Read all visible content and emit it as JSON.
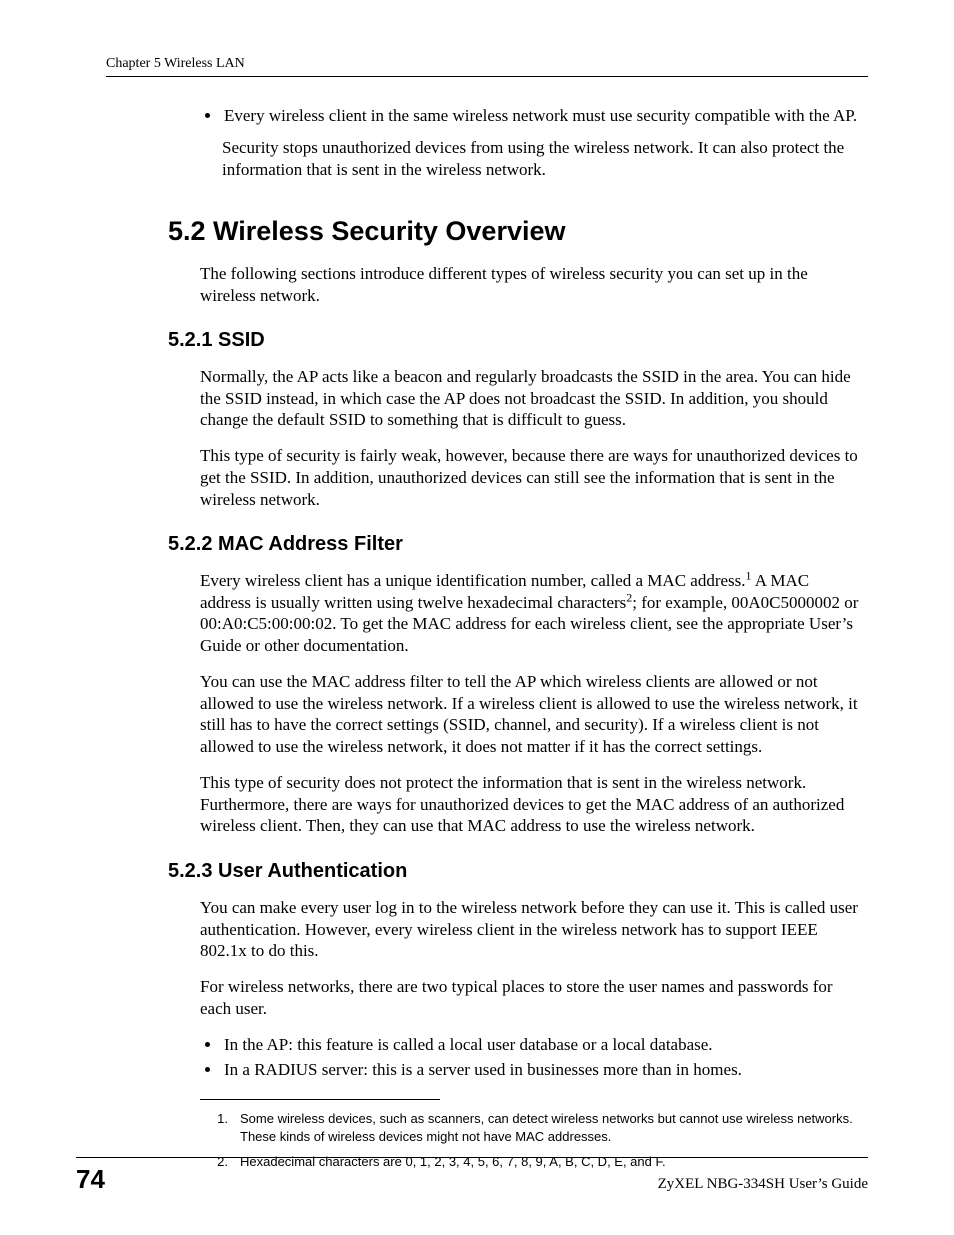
{
  "header": {
    "chapter": "Chapter 5 Wireless LAN"
  },
  "intro": {
    "bullet": "Every wireless client in the same wireless network must use security compatible with the AP.",
    "after": "Security stops unauthorized devices from using the wireless network. It can also protect the information that is sent in the wireless network."
  },
  "section": {
    "num_title": "5.2  Wireless Security Overview",
    "intro": "The following sections introduce different types of wireless security you can set up in the wireless network."
  },
  "ssid": {
    "heading": "5.2.1  SSID",
    "p1": "Normally, the AP acts like a beacon and regularly broadcasts the SSID in the area. You can hide the SSID instead, in which case the AP does not broadcast the SSID. In addition, you should change the default SSID to something that is difficult to guess.",
    "p2": "This type of security is fairly weak, however, because there are ways for unauthorized devices to get the SSID. In addition, unauthorized devices can still see the information that is sent in the wireless network."
  },
  "mac": {
    "heading": "5.2.2  MAC Address Filter",
    "p1a": "Every wireless client has a unique identification number, called a MAC address.",
    "p1b": " A MAC address is usually written using twelve hexadecimal characters",
    "p1c": "; for example, 00A0C5000002 or 00:A0:C5:00:00:02. To get the MAC address for each wireless client, see the appropriate User’s Guide or other documentation.",
    "p2": "You can use the MAC address filter to tell the AP which wireless clients are allowed or not allowed to use the wireless network. If a wireless client is allowed to use the wireless network, it still has to have the correct settings (SSID, channel, and security). If a wireless client is not allowed to use the wireless network, it does not matter if it has the correct settings.",
    "p3": "This type of security does not protect the information that is sent in the wireless network. Furthermore, there are ways for unauthorized devices to get the MAC address of an authorized wireless client. Then, they can use that MAC address to use the wireless network."
  },
  "auth": {
    "heading": "5.2.3  User Authentication",
    "p1": "You can make every user log in to the wireless network before they can use it. This is called user authentication. However, every wireless client in the wireless network has to support IEEE 802.1x to do this.",
    "p2": "For wireless networks, there are two typical places to store the user names and passwords for each user.",
    "b1": "In the AP: this feature is called a local user database or a local database.",
    "b2": "In a RADIUS server: this is a server used in businesses more than in homes."
  },
  "footnotes": {
    "n1": "1.",
    "t1": "Some wireless devices, such as scanners, can detect wireless networks but cannot use wireless networks. These kinds of wireless devices might not have MAC addresses.",
    "n2": "2.",
    "t2": "Hexadecimal characters are 0, 1, 2, 3, 4, 5, 6, 7, 8, 9, A, B, C, D, E, and F."
  },
  "footer": {
    "page": "74",
    "guide": "ZyXEL NBG-334SH User’s Guide"
  }
}
